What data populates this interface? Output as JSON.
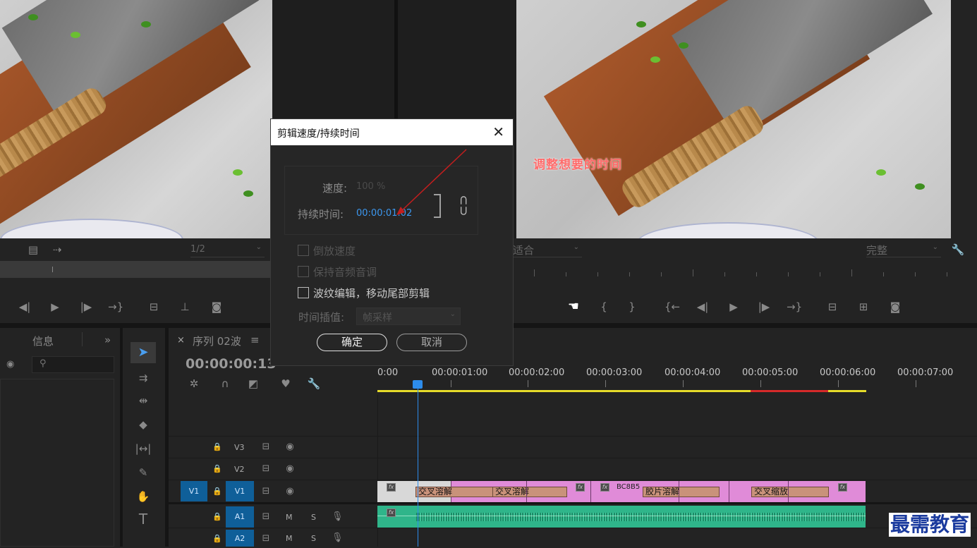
{
  "dialog": {
    "title": "剪辑速度/持续时间",
    "speed_label": "速度:",
    "speed_value": "100 %",
    "duration_label": "持续时间:",
    "duration_value": "00:00:01:02",
    "reverse_label": "倒放速度",
    "pitch_label": "保持音频音调",
    "ripple_label": "波纹编辑，移动尾部剪辑",
    "interp_label": "时间插值:",
    "interp_value": "帧采样",
    "ok_label": "确定",
    "cancel_label": "取消",
    "reverse_checked": false,
    "pitch_checked": false,
    "ripple_checked": false
  },
  "annotation": {
    "text": "调整想要的时间",
    "color": "#ff6b6b"
  },
  "source_monitor": {
    "resolution_value": "1/2"
  },
  "program_monitor": {
    "fit_value": "适合",
    "quality_value": "完整"
  },
  "info_panel": {
    "title": "信息"
  },
  "timeline": {
    "sequence_name": "序列 02波",
    "current_time": "00:00:00:13",
    "ruler": [
      "0:00",
      "00:00:01:00",
      "00:00:02:00",
      "00:00:03:00",
      "00:00:04:00",
      "00:00:05:00",
      "00:00:06:00",
      "00:00:07:00"
    ],
    "tracks": {
      "v3": "V3",
      "v2": "V2",
      "v1": "V1",
      "a1": "A1",
      "a2": "A2",
      "v1_src": "V1",
      "a1_src": "A1",
      "a2_src": "A2",
      "m": "M",
      "s": "S"
    },
    "clips": {
      "t1": "交叉溶解",
      "t2": "交叉溶解",
      "t3": "胶片溶解",
      "t4": "交叉缩放",
      "clip_name": "BC8B5"
    }
  },
  "watermark": "最需教育",
  "colors": {
    "accent_blue": "#2d8ceb",
    "clip_pink": "#e08bd8",
    "audio_green": "#2fb58a",
    "work_yellow": "#e6dc2a",
    "render_red": "#d62a2a"
  }
}
